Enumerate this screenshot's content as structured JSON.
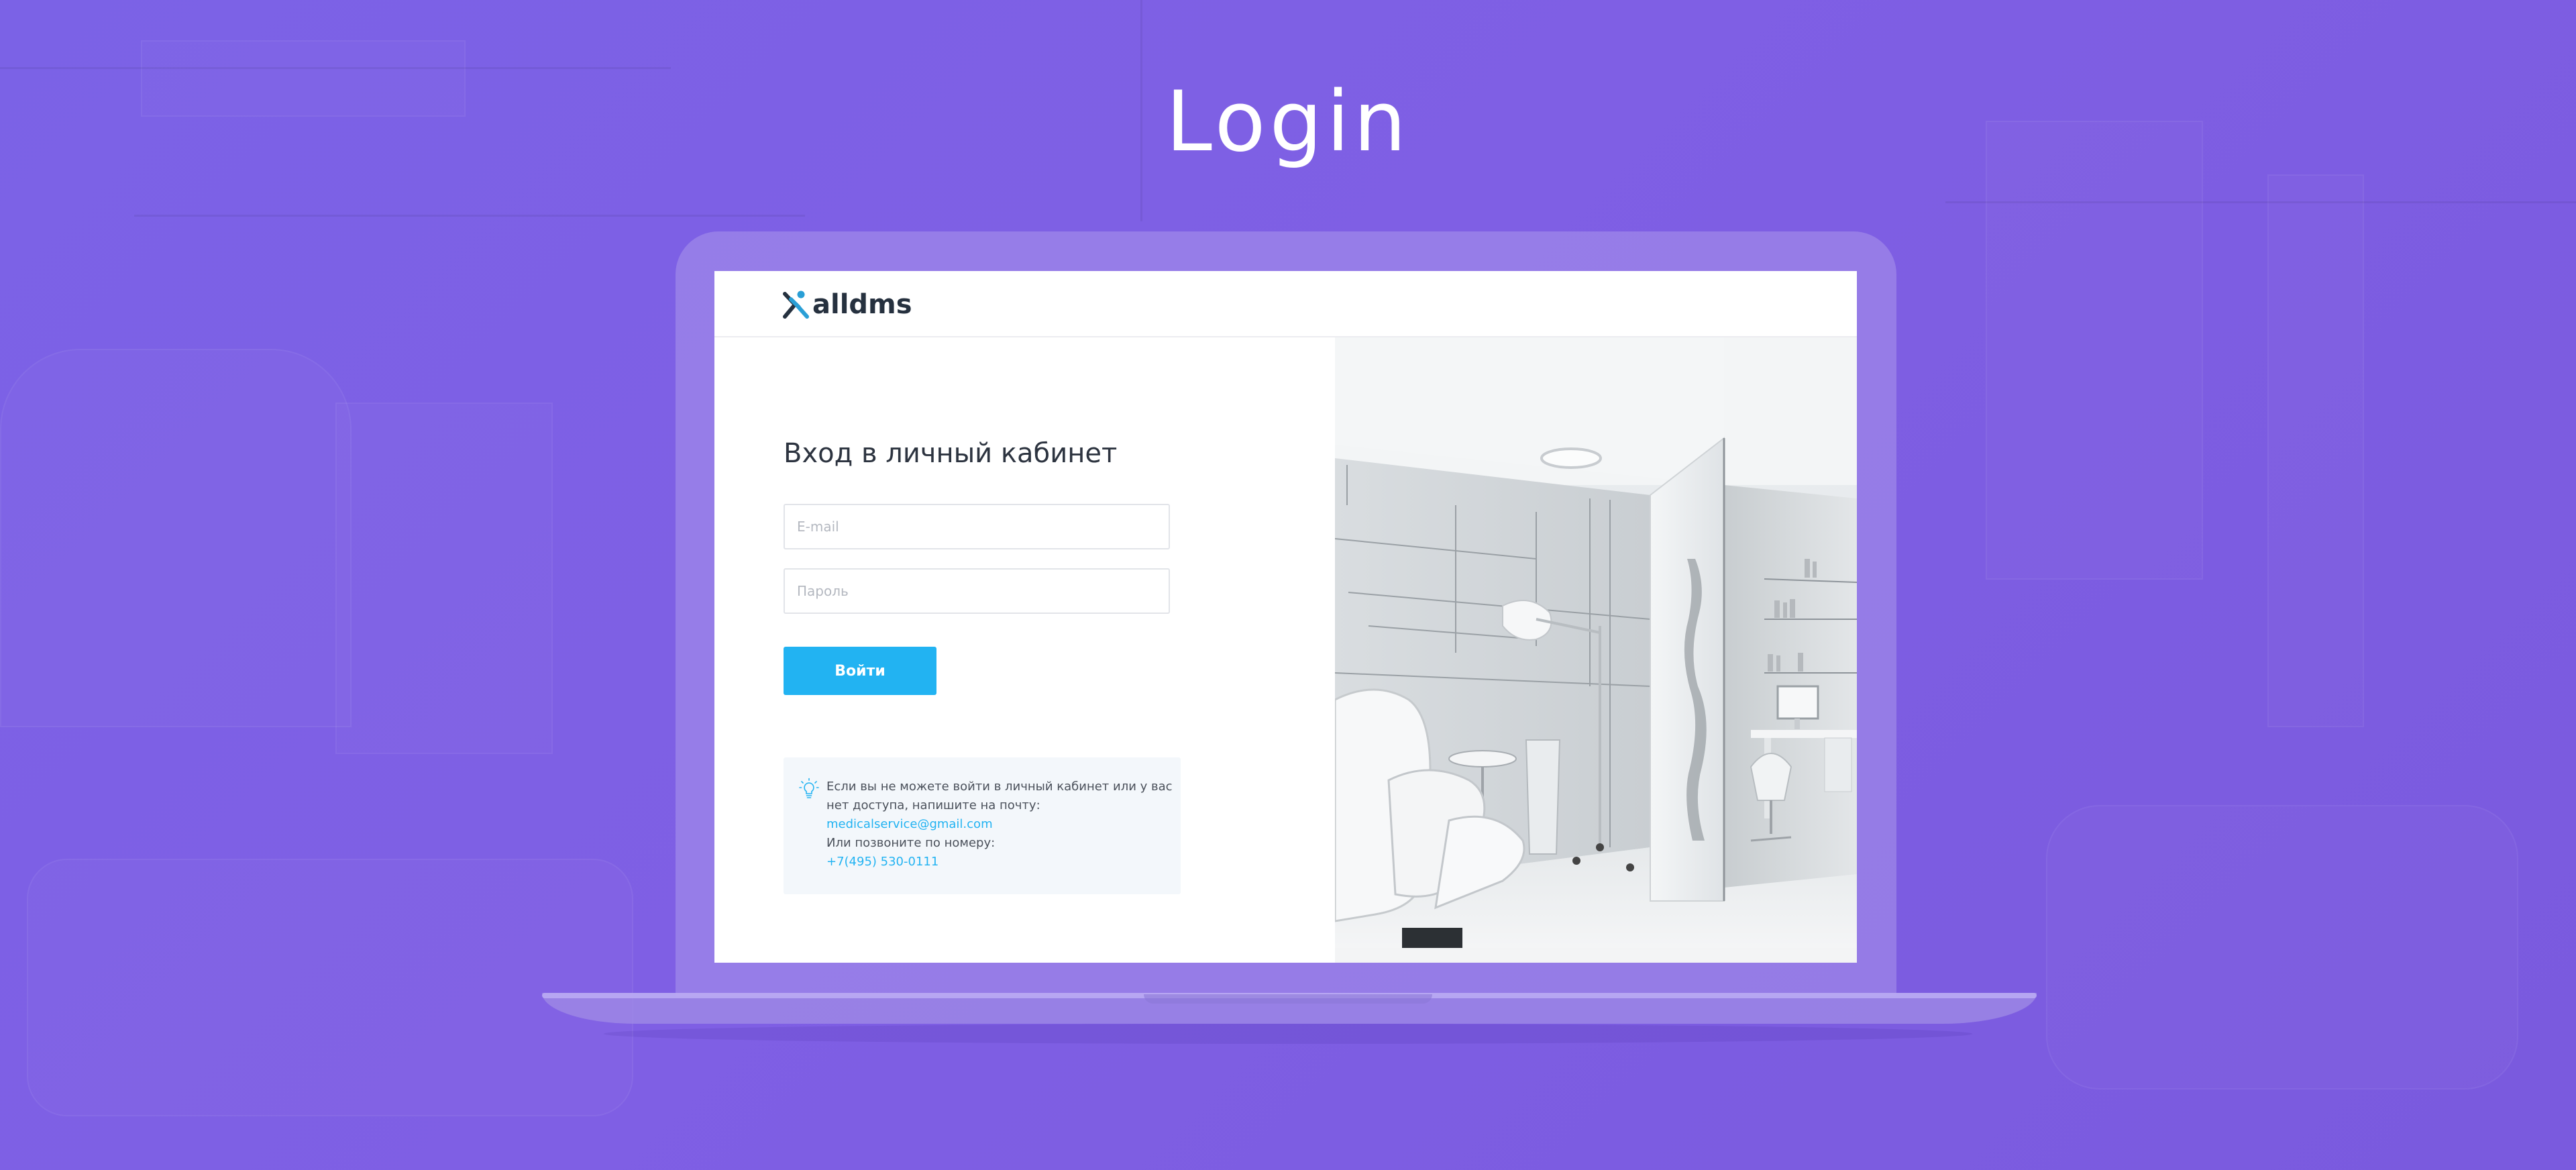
{
  "page": {
    "title": "Login"
  },
  "site": {
    "logo_text": "alldms",
    "login_heading": "Вход в личный кабинет",
    "email_placeholder": "E-mail",
    "password_placeholder": "Пароль",
    "submit_label": "Войти",
    "help": {
      "line1": "Если вы не можете войти в личный кабинет или у вас",
      "line2": "нет доступа, напишите на почту:",
      "email": "medicalservice@gmail.com",
      "line3": "Или позвоните по  номеру:",
      "phone": "+7(495) 530-0111"
    }
  },
  "colors": {
    "background": "#7b5ee4",
    "accent": "#22b3f2",
    "logo_mark": "#2a9fd6",
    "text_dark": "#2d3440"
  },
  "icons": {
    "help": "lightbulb-icon",
    "logo": "alldms-x-logo-icon"
  }
}
